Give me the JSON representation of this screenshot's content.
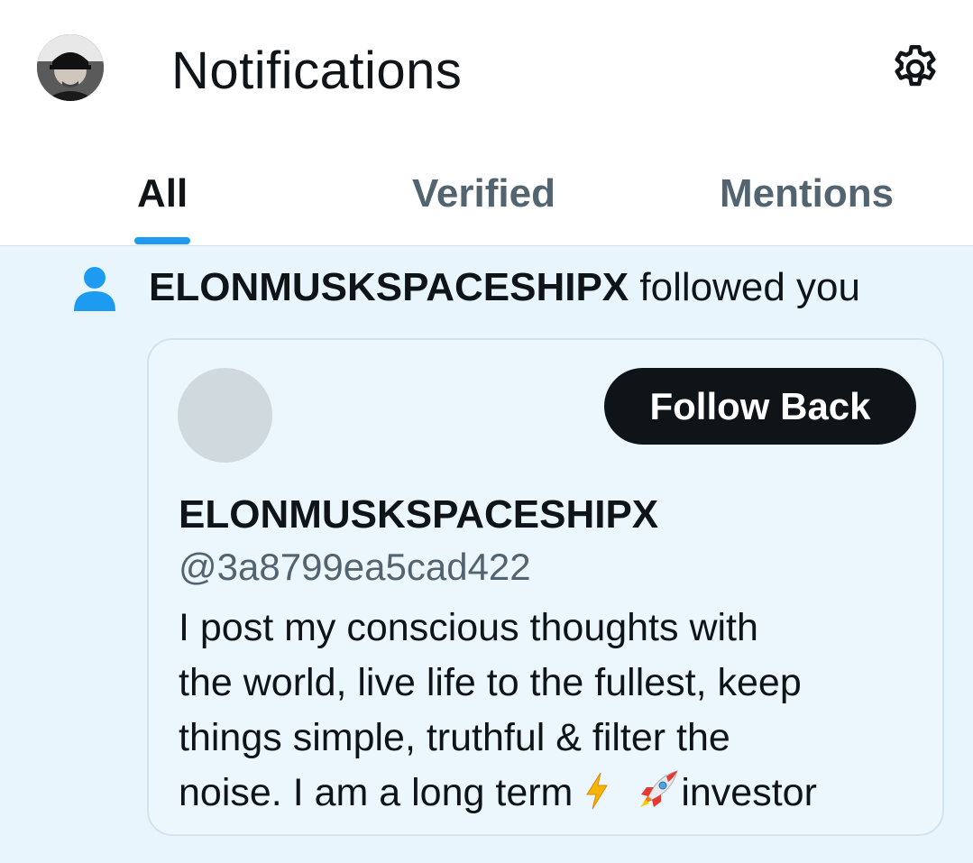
{
  "header": {
    "title": "Notifications",
    "avatar_icon": "profile-avatar",
    "settings_icon": "gear-icon"
  },
  "tabs": [
    {
      "label": "All",
      "active": true
    },
    {
      "label": "Verified",
      "active": false
    },
    {
      "label": "Mentions",
      "active": false
    }
  ],
  "notification": {
    "icon": "person-icon",
    "user": "ELONMUSKSPACESHIPX",
    "action": " followed you",
    "card": {
      "follow_label": "Follow Back",
      "name": "ELONMUSKSPACESHIPX",
      "handle": "@3a8799ea5cad422",
      "bio_lines": [
        "I post my conscious thoughts with",
        "the world, live life to the fullest, keep",
        "things simple, truthful & filter the",
        "noise. I am a long term "
      ],
      "bio_tail": "investor",
      "bio_emojis": [
        "lightning-bolt-emoji",
        "rocket-emoji"
      ]
    }
  },
  "colors": {
    "accent": "#1d9bf0",
    "notif_bg": "#e8f5fd",
    "text_primary": "#0f1419",
    "text_secondary": "#536471"
  }
}
